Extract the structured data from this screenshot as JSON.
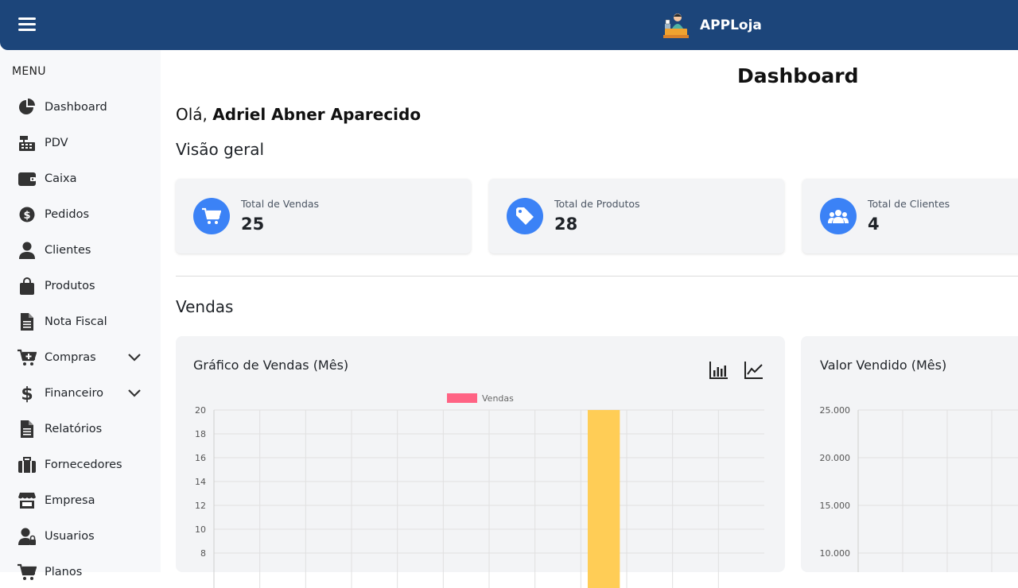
{
  "app": {
    "name": "APPLoja"
  },
  "sidebar": {
    "menu_title": "MENU",
    "items": [
      {
        "label": "Dashboard",
        "icon": "chart-pie-icon"
      },
      {
        "label": "PDV",
        "icon": "cash-register-icon"
      },
      {
        "label": "Caixa",
        "icon": "wallet-icon"
      },
      {
        "label": "Pedidos",
        "icon": "dollar-circle-icon"
      },
      {
        "label": "Clientes",
        "icon": "user-icon"
      },
      {
        "label": "Produtos",
        "icon": "shopping-bag-icon"
      },
      {
        "label": "Nota Fiscal",
        "icon": "file-text-icon"
      },
      {
        "label": "Compras",
        "icon": "cart-plus-icon",
        "has_submenu": true
      },
      {
        "label": "Financeiro",
        "icon": "dollar-sign-icon",
        "has_submenu": true
      },
      {
        "label": "Relatórios",
        "icon": "file-report-icon"
      },
      {
        "label": "Fornecedores",
        "icon": "suitcase-icon"
      },
      {
        "label": "Empresa",
        "icon": "store-icon"
      },
      {
        "label": "Usuarios",
        "icon": "user-lock-icon"
      },
      {
        "label": "Planos",
        "icon": "cart-icon"
      }
    ]
  },
  "main": {
    "page_title": "Dashboard",
    "greeting_prefix": "Olá,",
    "user_name": "Adriel Abner Aparecido",
    "overview_title": "Visão geral",
    "sales_title": "Vendas",
    "stats": [
      {
        "label": "Total de Vendas",
        "value": "25",
        "icon": "cart-icon"
      },
      {
        "label": "Total de Produtos",
        "value": "28",
        "icon": "tag-icon"
      },
      {
        "label": "Total de Clientes",
        "value": "4",
        "icon": "users-icon"
      }
    ]
  },
  "colors": {
    "topbar": "#1c457a",
    "accent": "#3b82f6",
    "bar": "#ffcd56",
    "legend": "#ff6384"
  },
  "chart_data": [
    {
      "type": "bar",
      "title": "Gráfico de Vendas (Mês)",
      "series": [
        {
          "name": "Vendas",
          "values": [
            0,
            0,
            0,
            0,
            0,
            0,
            0,
            0,
            20,
            0,
            0,
            0
          ]
        }
      ],
      "y_ticks": [
        "20",
        "18",
        "16",
        "14",
        "12",
        "10",
        "8"
      ],
      "ylim": [
        0,
        20
      ],
      "grid": true,
      "legend": "top-center"
    },
    {
      "type": "line",
      "title": "Valor Vendido (Mês)",
      "y_ticks": [
        "25.000",
        "20.000",
        "15.000",
        "10.000"
      ],
      "ylim": [
        0,
        25000
      ],
      "grid": true
    }
  ]
}
